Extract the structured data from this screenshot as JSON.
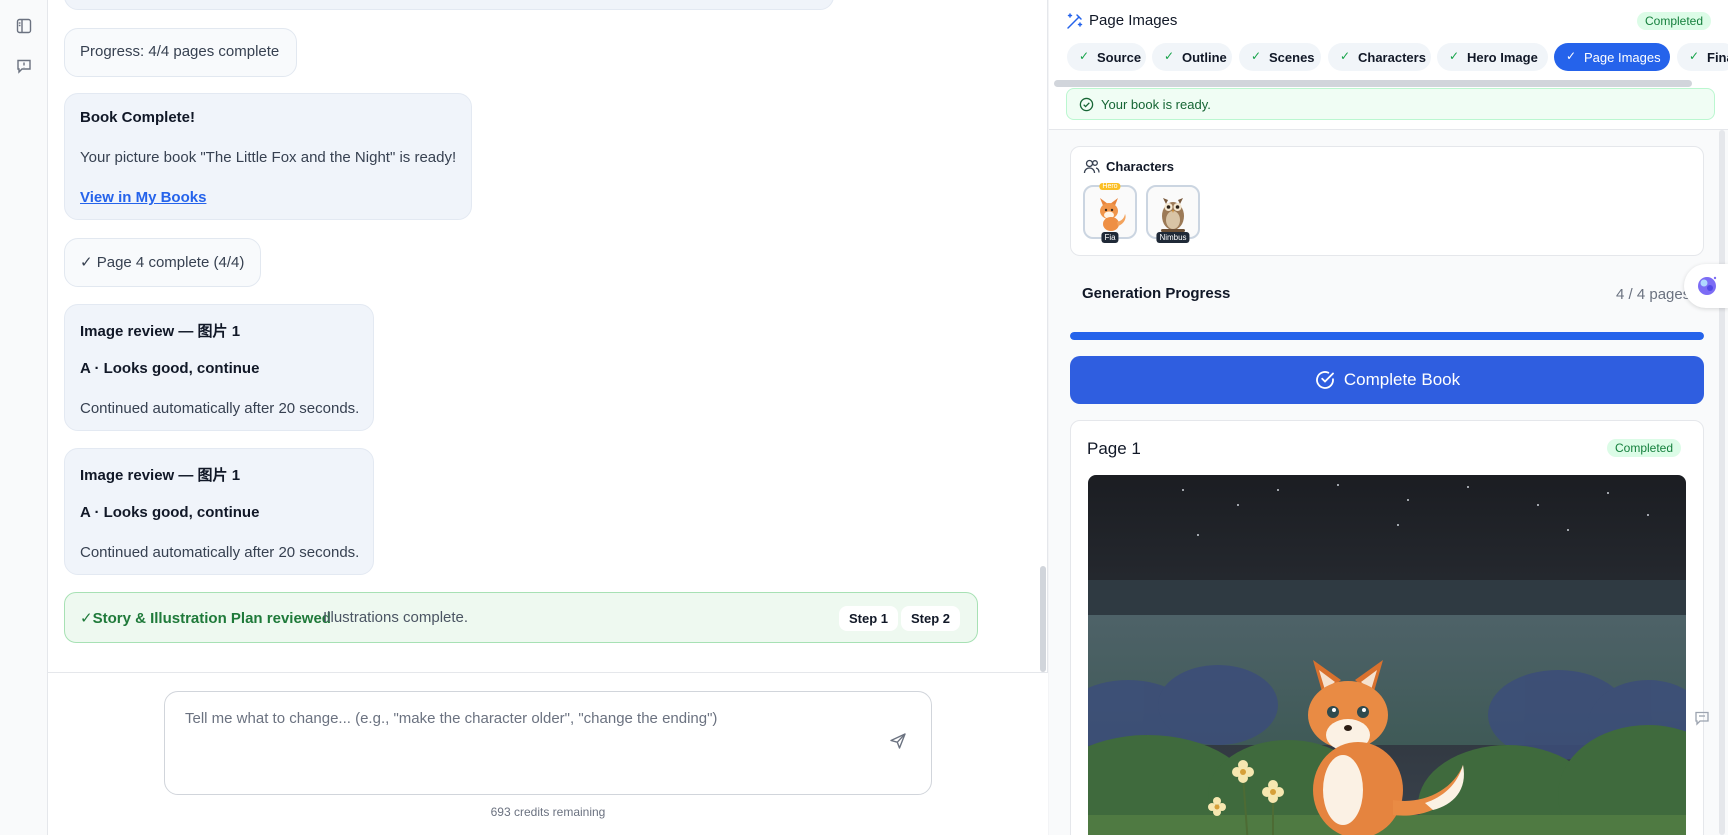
{
  "chat": {
    "progress": "Progress: 4/4 pages complete",
    "book_complete": {
      "title": "Book Complete!",
      "message": "Your picture book \"The Little Fox and the Night\" is ready!",
      "link": "View in My Books"
    },
    "page4": "✓ Page 4 complete (4/4)",
    "reviews": [
      {
        "title": "Image review — 图片 1",
        "choice": "A · Looks good, continue",
        "note": "Continued automatically after 20 seconds."
      },
      {
        "title": "Image review — 图片 1",
        "choice": "A · Looks good, continue",
        "note": "Continued automatically after 20 seconds."
      }
    ],
    "plan": {
      "label": "✓Story & Illustration Plan reviewed",
      "desc": "Illustrations complete.",
      "steps": [
        "Step 1",
        "Step 2"
      ]
    },
    "composer": {
      "placeholder": "Tell me what to change... (e.g., \"make the character older\", \"change the ending\")"
    },
    "credits": "693 credits remaining"
  },
  "panel": {
    "title": "Page Images",
    "status": "Completed",
    "tabs": [
      {
        "label": "Source",
        "active": false
      },
      {
        "label": "Outline",
        "active": false
      },
      {
        "label": "Scenes",
        "active": false
      },
      {
        "label": "Characters",
        "active": false
      },
      {
        "label": "Hero Image",
        "active": false
      },
      {
        "label": "Page Images",
        "active": true
      },
      {
        "label": "Final",
        "active": false
      }
    ],
    "ready": "Your book is ready.",
    "characters": {
      "heading": "Characters",
      "items": [
        {
          "name": "Fia",
          "tag": "Hero",
          "icon": "fox-icon"
        },
        {
          "name": "Nimbus",
          "icon": "owl-icon"
        }
      ]
    },
    "generation": {
      "title": "Generation Progress",
      "count": "4 / 4 pages",
      "progress": 1.0
    },
    "complete_button": "Complete Book",
    "page": {
      "title": "Page 1",
      "status": "Completed"
    }
  },
  "colors": {
    "accent": "#2563eb",
    "success": "#15803d",
    "success_bg": "#dcfce7"
  }
}
